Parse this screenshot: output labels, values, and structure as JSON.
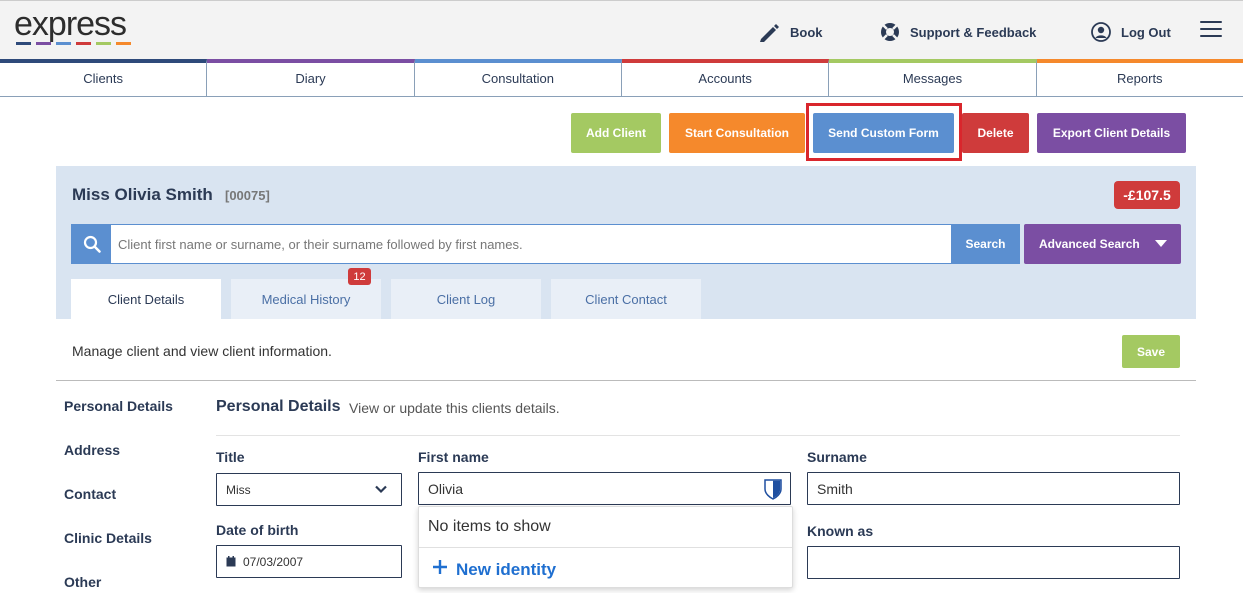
{
  "header": {
    "logo_text": "express",
    "logo_colors": [
      "#2e4a7a",
      "#7b4ea3",
      "#5b8fd0",
      "#cf3b3b",
      "#a4c962",
      "#f5892c"
    ],
    "book_label": "Book",
    "support_label": "Support & Feedback",
    "logout_label": "Log Out"
  },
  "nav": {
    "tabs": [
      {
        "label": "Clients",
        "color": "#2e4a7a"
      },
      {
        "label": "Diary",
        "color": "#7b4ea3"
      },
      {
        "label": "Consultation",
        "color": "#5b8fd0"
      },
      {
        "label": "Accounts",
        "color": "#cf3b3b"
      },
      {
        "label": "Messages",
        "color": "#a4c962"
      },
      {
        "label": "Reports",
        "color": "#f5892c"
      }
    ]
  },
  "actions": {
    "add_client": "Add Client",
    "start_consultation": "Start Consultation",
    "send_custom_form": "Send Custom Form",
    "delete": "Delete",
    "export_client_details": "Export Client Details"
  },
  "client": {
    "name": "Miss Olivia Smith",
    "id": "[00075]",
    "balance": "-£107.5"
  },
  "search": {
    "placeholder": "Client first name or surname, or their surname followed by first names.",
    "button": "Search",
    "advanced": "Advanced Search"
  },
  "client_tabs": [
    {
      "label": "Client Details"
    },
    {
      "label": "Medical History",
      "badge": "12"
    },
    {
      "label": "Client Log"
    },
    {
      "label": "Client Contact"
    }
  ],
  "body": {
    "manage_text": "Manage client and view client information.",
    "save": "Save"
  },
  "sidebar": {
    "items": [
      "Personal Details",
      "Address",
      "Contact",
      "Clinic Details",
      "Other"
    ]
  },
  "section": {
    "title": "Personal Details",
    "description": "View or update this clients details."
  },
  "form": {
    "title_label": "Title",
    "title_value": "Miss",
    "first_name_label": "First name",
    "first_name_value": "Olivia",
    "surname_label": "Surname",
    "surname_value": "Smith",
    "dob_label": "Date of birth",
    "dob_value": "07/03/2007",
    "known_as_label": "Known as",
    "known_as_value": ""
  },
  "popup": {
    "empty_text": "No items to show",
    "new_identity": "New identity"
  }
}
